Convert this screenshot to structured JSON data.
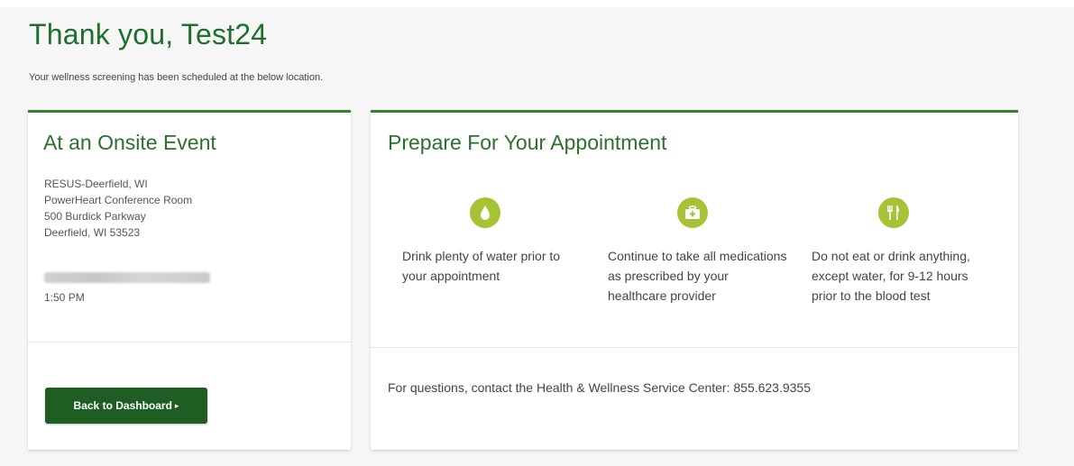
{
  "header": {
    "title": "Thank you, Test24",
    "subtitle": "Your wellness screening has been scheduled at the below location."
  },
  "location_card": {
    "title": "At an Onsite Event",
    "address_lines": [
      "RESUS-Deerfield, WI",
      "PowerHeart Conference Room",
      "500 Burdick Parkway",
      "Deerfield, WI 53523"
    ],
    "time": "1:50 PM",
    "button_label": "Back to Dashboard",
    "button_caret": "▸"
  },
  "prepare_card": {
    "title": "Prepare For Your Appointment",
    "tips": [
      {
        "icon": "water-drop-icon",
        "text": "Drink plenty of water prior to your appointment"
      },
      {
        "icon": "medical-kit-icon",
        "text": "Continue to take all medications as prescribed by your healthcare provider"
      },
      {
        "icon": "utensils-icon",
        "text": "Do not eat or drink anything, except water, for 9-12 hours prior to the blood test"
      }
    ],
    "contact": "For questions, contact the Health & Wellness Service Center: 855.623.9355"
  },
  "colors": {
    "brand_green": "#1f6e2c",
    "button_green": "#1f5e23",
    "icon_green": "#a5c334",
    "card_border": "#3a7d33"
  }
}
